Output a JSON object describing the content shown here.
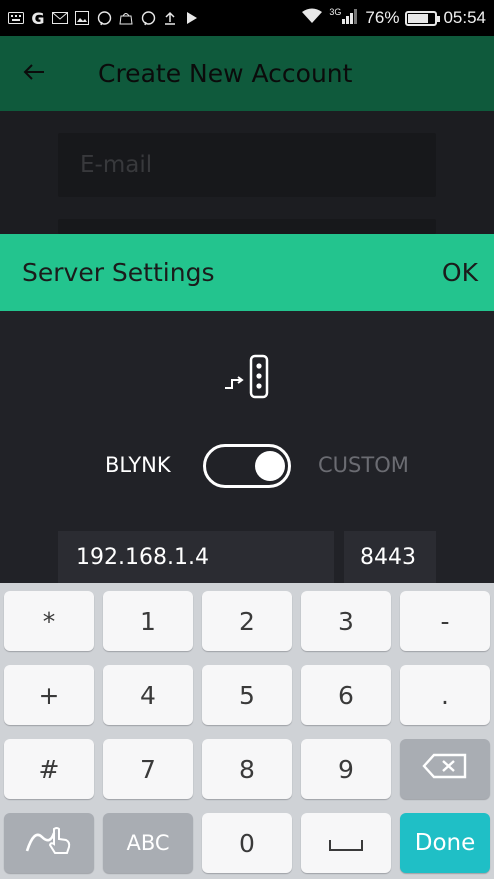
{
  "status_bar": {
    "left_icons": [
      "keyboard-icon",
      "google-icon",
      "mail-icon",
      "image-icon",
      "viber-icon",
      "shopping-bag-icon",
      "viber-icon",
      "upload-icon",
      "play-store-icon"
    ],
    "network_label": "3G",
    "battery": "76%",
    "battery_level": 0.76,
    "time": "05:54"
  },
  "app_bar": {
    "back_icon": "back-arrow-icon",
    "title": "Create New Account"
  },
  "background_form": {
    "email_placeholder": "E-mail"
  },
  "dialog": {
    "title": "Server Settings",
    "ok_label": "OK",
    "server_icon": "server-icon",
    "toggle_left_label": "BLYNK",
    "toggle_right_label": "CUSTOM",
    "toggle_state": "on",
    "ip_value": "192.168.1.4",
    "port_value": "8443",
    "accent_color": "#23c48e"
  },
  "keyboard": {
    "row1": [
      "*",
      "1",
      "2",
      "3",
      "-"
    ],
    "row2": [
      "+",
      "4",
      "5",
      "6",
      "."
    ],
    "row3": [
      "#",
      "7",
      "8",
      "9"
    ],
    "backspace_icon": "backspace-icon",
    "handwriting_icon": "handwriting-icon",
    "abc_label": "ABC",
    "zero_label": "0",
    "space_icon": "space-icon",
    "done_label": "Done",
    "done_color": "#1fbfc6"
  }
}
